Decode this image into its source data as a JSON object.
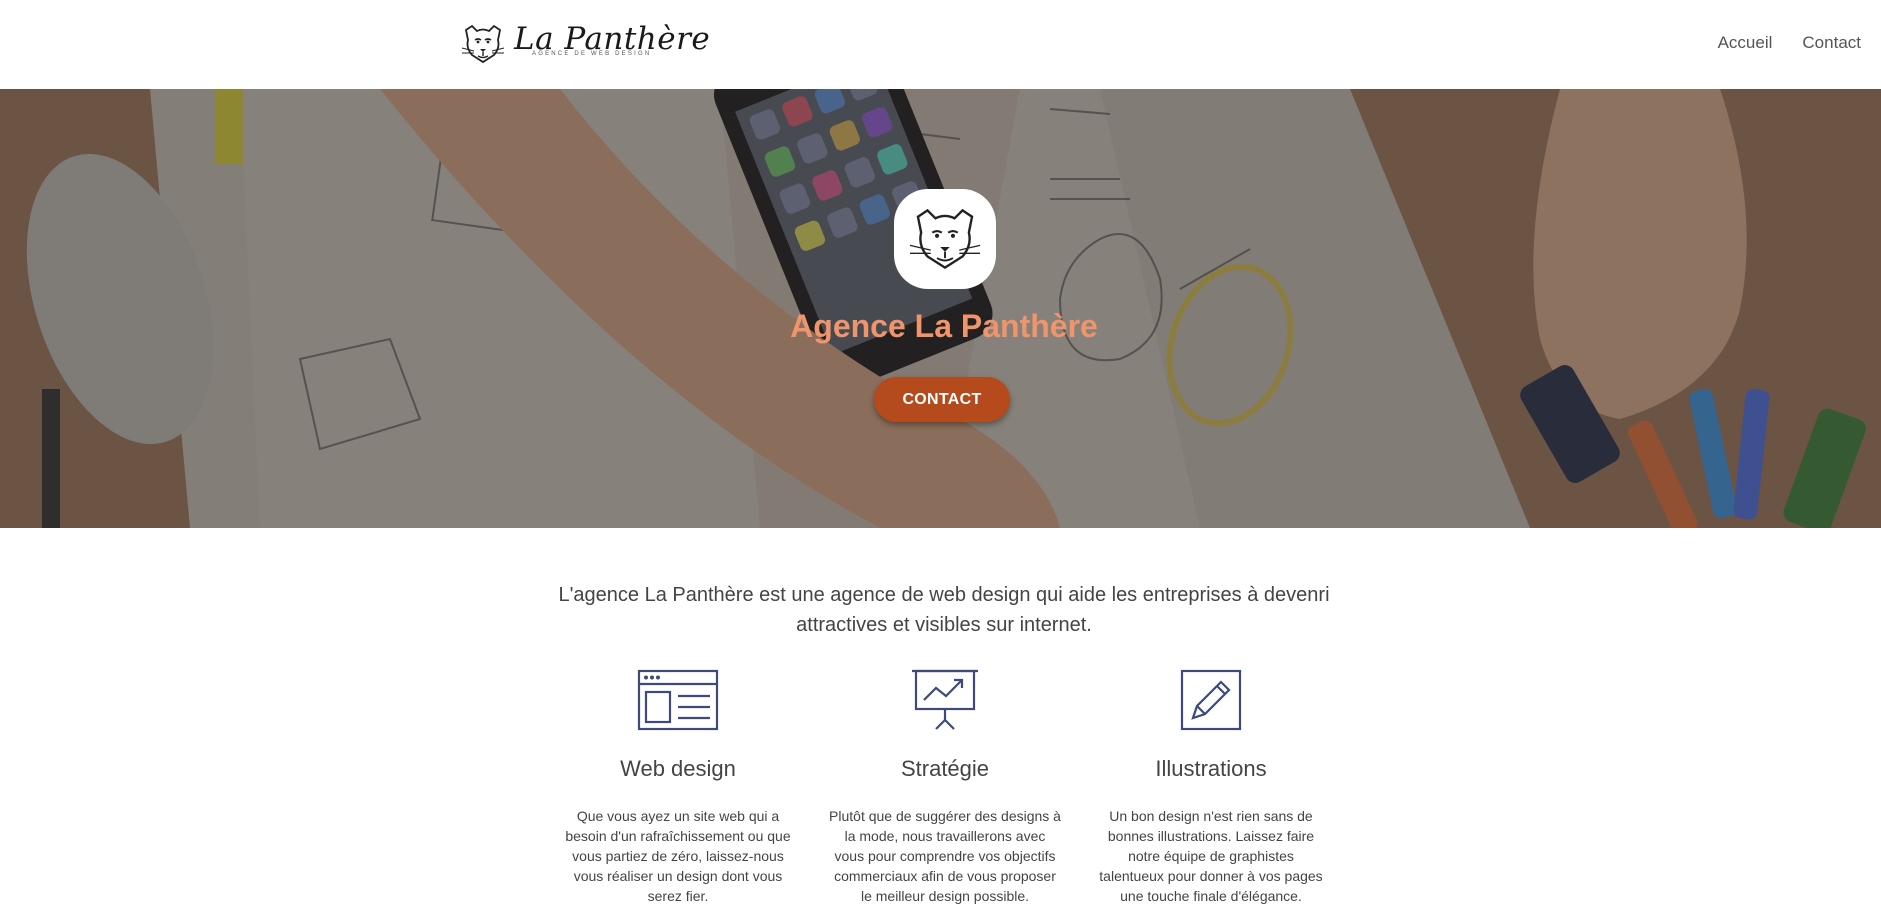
{
  "header": {
    "logo_name": "La Panthère",
    "logo_tagline": "AGENCE DE WEB DESIGN",
    "nav": [
      {
        "label": "Accueil"
      },
      {
        "label": "Contact"
      }
    ]
  },
  "hero": {
    "title": "Agence La Panthère",
    "button_label": "CONTACT",
    "colors": {
      "title": "#f0946b",
      "button": "#b54a1c"
    }
  },
  "intro": {
    "text": "L'agence La Panthère est une agence de web design qui aide les entreprises à devenri attractives et visibles sur internet."
  },
  "services": [
    {
      "icon": "browser-window-icon",
      "title": "Web design",
      "text": "Que vous ayez un site web qui a besoin d'un rafraîchissement ou que vous partiez de zéro, laissez-nous vous réaliser un design dont vous serez fier."
    },
    {
      "icon": "presentation-chart-icon",
      "title": "Stratégie",
      "text": "Plutôt que de suggérer des designs à la mode, nous travaillerons avec vous pour comprendre vos objectifs commerciaux afin de vous proposer le meilleur design possible."
    },
    {
      "icon": "pencil-edit-icon",
      "title": "Illustrations",
      "text": "Un bon design n'est rien sans de bonnes illustrations. Laissez faire notre équipe de graphistes talentueux pour donner à vos pages une touche finale d'élégance."
    }
  ]
}
